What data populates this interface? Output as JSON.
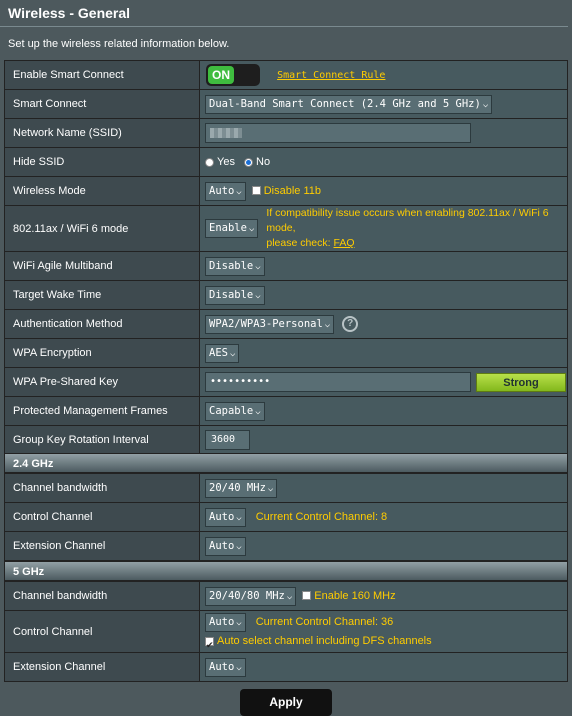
{
  "header": {
    "title": "Wireless - General",
    "description": "Set up the wireless related information below."
  },
  "general": {
    "smart_connect_enable": {
      "label": "Enable Smart Connect",
      "toggle": "ON",
      "link": "Smart Connect Rule"
    },
    "smart_connect": {
      "label": "Smart Connect",
      "value": "Dual-Band Smart Connect (2.4 GHz and 5 GHz)"
    },
    "ssid": {
      "label": "Network Name (SSID)",
      "value": ""
    },
    "hide_ssid": {
      "label": "Hide SSID",
      "yes": "Yes",
      "no": "No",
      "selected": "No"
    },
    "wireless_mode": {
      "label": "Wireless Mode",
      "value": "Auto",
      "checkbox_label": "Disable 11b"
    },
    "wifi6": {
      "label": "802.11ax / WiFi 6 mode",
      "value": "Enable",
      "note_line1": "If compatibility issue occurs when enabling 802.11ax / WiFi 6 mode,",
      "note_line2": "please check:",
      "faq": "FAQ"
    },
    "agile_multiband": {
      "label": "WiFi Agile Multiband",
      "value": "Disable"
    },
    "target_wake": {
      "label": "Target Wake Time",
      "value": "Disable"
    },
    "auth_method": {
      "label": "Authentication Method",
      "value": "WPA2/WPA3-Personal",
      "help": "?"
    },
    "wpa_encryption": {
      "label": "WPA Encryption",
      "value": "AES"
    },
    "psk": {
      "label": "WPA Pre-Shared Key",
      "value": "••••••••••",
      "strength": "Strong"
    },
    "pmf": {
      "label": "Protected Management Frames",
      "value": "Capable"
    },
    "gkri": {
      "label": "Group Key Rotation Interval",
      "value": "3600"
    }
  },
  "band24": {
    "title": "2.4 GHz",
    "bandwidth": {
      "label": "Channel bandwidth",
      "value": "20/40 MHz"
    },
    "control": {
      "label": "Control Channel",
      "value": "Auto",
      "current": "Current Control Channel: 8"
    },
    "extension": {
      "label": "Extension Channel",
      "value": "Auto"
    }
  },
  "band5": {
    "title": "5 GHz",
    "bandwidth": {
      "label": "Channel bandwidth",
      "value": "20/40/80 MHz",
      "checkbox_label": "Enable 160 MHz"
    },
    "control": {
      "label": "Control Channel",
      "value": "Auto",
      "current": "Current Control Channel: 36",
      "dfs_label": "Auto select channel including DFS channels"
    },
    "extension": {
      "label": "Extension Channel",
      "value": "Auto"
    }
  },
  "apply_label": "Apply",
  "colors": {
    "accent_yellow": "#ffcc00",
    "toggle_on": "#3fbd3f",
    "strength": "#a6d22e",
    "panel": "#4d595d"
  }
}
